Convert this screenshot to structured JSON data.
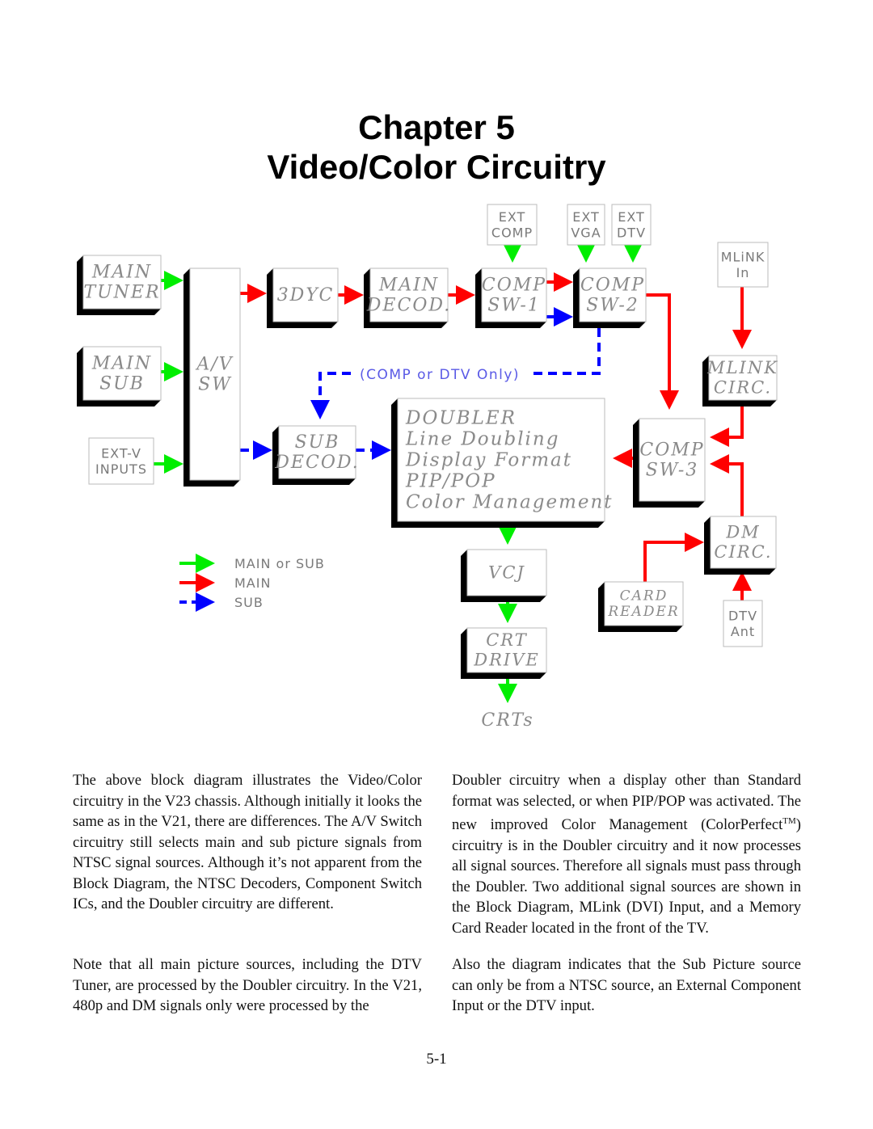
{
  "title": {
    "line1": "Chapter 5",
    "line2": "Video/Color Circuitry"
  },
  "colors": {
    "main_or_sub": "#00ee00",
    "main": "#ff0000",
    "sub": "#0000ff",
    "block_shadow": "#000000",
    "block_text": "#8a8a8a"
  },
  "diagram": {
    "blocks": {
      "main_tuner": [
        "MAIN",
        "TUNER"
      ],
      "main_sub": [
        "MAIN",
        "SUB"
      ],
      "av_sw": [
        "A/V",
        "SW"
      ],
      "dyc": [
        "3DYC"
      ],
      "main_decod": [
        "MAIN",
        "DECOD."
      ],
      "comp_sw1": [
        "COMP",
        "SW-1"
      ],
      "comp_sw2": [
        "COMP",
        "SW-2"
      ],
      "mlink_circ": [
        "MLINK",
        "CIRC."
      ],
      "sub_decod": [
        "SUB",
        "DECOD."
      ],
      "doubler": [
        "DOUBLER",
        "Line  Doubling",
        "Display  Format",
        "PIP/POP",
        "Color  Management"
      ],
      "comp_sw3": [
        "COMP",
        "SW-3"
      ],
      "dm_circ": [
        "DM",
        "CIRC."
      ],
      "vcj": [
        "VCJ"
      ],
      "card_reader": [
        "CARD",
        "READER"
      ],
      "crt_drive": [
        "CRT",
        "DRIVE"
      ]
    },
    "sources": {
      "ext_v": [
        "EXT-V",
        "INPUTS"
      ],
      "ext_comp": [
        "EXT",
        "COMP"
      ],
      "ext_vga": [
        "EXT",
        "VGA"
      ],
      "ext_dtv": [
        "EXT",
        "DTV"
      ],
      "mlink_in": [
        "MLiNK",
        "In"
      ],
      "dtv_ant": [
        "DTV",
        "Ant"
      ]
    },
    "crts_label": "CRTs",
    "sub_path_note": "(COMP  or  DTV  Only)",
    "legend": [
      {
        "label": "MAIN  or  SUB",
        "style": "solid",
        "color": "#00ee00"
      },
      {
        "label": "MAIN",
        "style": "solid",
        "color": "#ff0000"
      },
      {
        "label": "SUB",
        "style": "dashed",
        "color": "#0000ff"
      }
    ]
  },
  "body": {
    "left_p1": "The above block diagram illustrates the Video/Color circuitry in the V23 chassis.  Although initially it looks the same as in the V21, there are differences.  The A/V Switch circuitry still selects main and sub picture signals from NTSC signal sources.  Although it’s not apparent from the Block Diagram, the NTSC Decoders, Component Switch ICs, and the Doubler circuitry are different.",
    "left_p2": "Note that all main picture sources, including the DTV Tuner, are processed by the Doubler circuitry.  In the V21, 480p and DM signals only were processed by the",
    "right_p1_a": "Doubler circuitry when a display other than Standard format was selected, or when PIP/POP was activated. The new improved Color Management (ColorPerfect",
    "right_p1_tm": "TM",
    "right_p1_b": ") circuitry is in the Doubler circuitry and it now processes all signal sources.  Therefore all signals must pass through the Doubler. Two additional signal sources are shown in the Block Diagram, MLink (DVI) Input, and a Memory Card Reader located in the front of the TV.",
    "right_p2": "Also the diagram indicates that the Sub Picture source can only be from a NTSC source, an External Component  Input or the DTV input."
  },
  "page_number": "5-1"
}
